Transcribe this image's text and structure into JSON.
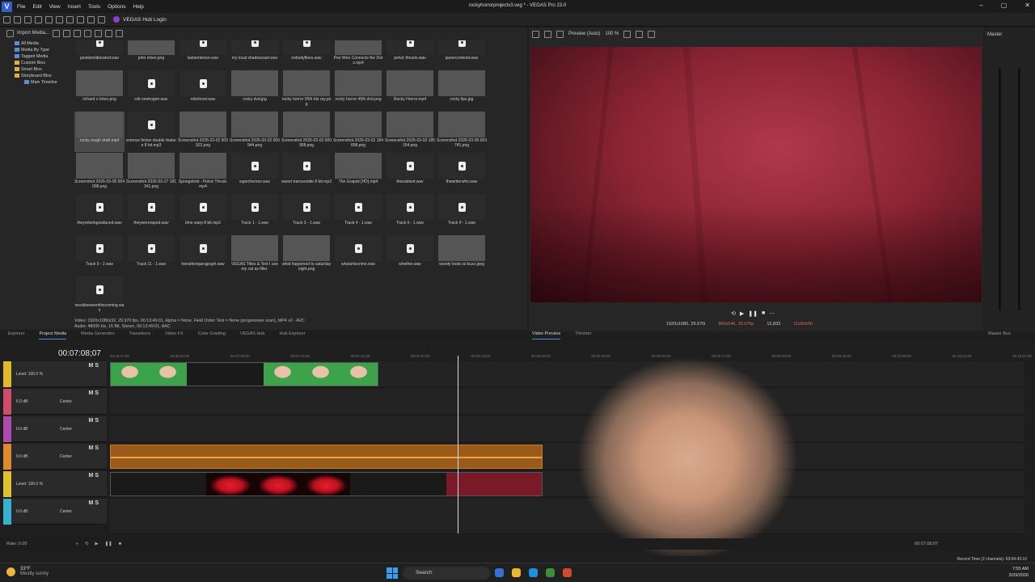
{
  "app": {
    "title": "rockyhorrorprojectv3.veg * - VEGAS Pro 23.0",
    "menu": [
      "File",
      "Edit",
      "View",
      "Insert",
      "Tools",
      "Options",
      "Help"
    ],
    "hub_login": "VEGAS Hub Login"
  },
  "project_media": {
    "toolbar_label": "Import Media...",
    "tree": [
      {
        "label": "All Media",
        "sub": false,
        "fold": false
      },
      {
        "label": "Media By Type",
        "sub": false,
        "fold": false
      },
      {
        "label": "Tagged Media",
        "sub": false,
        "fold": false
      },
      {
        "label": "Custom Bins",
        "sub": false,
        "fold": true
      },
      {
        "label": "Smart Bins",
        "sub": false,
        "fold": true
      },
      {
        "label": "Storyboard Bins",
        "sub": false,
        "fold": true
      },
      {
        "label": "Main Timeline",
        "sub": true,
        "fold": false
      }
    ],
    "items": [
      {
        "name": "janetismliberated.wav",
        "kind": "file"
      },
      {
        "name": "john oliver.png",
        "kind": "img"
      },
      {
        "name": "lastsentence.wav",
        "kind": "file"
      },
      {
        "name": "my local shadowcast.wav",
        "kind": "file"
      },
      {
        "name": "nobodyflees.wav",
        "kind": "file"
      },
      {
        "name": "Pee Wee Connects the Dots.mp4",
        "kind": "img"
      },
      {
        "name": "pelvic thrusts.wav",
        "kind": "file"
      },
      {
        "name": "queercontend.wav",
        "kind": "file"
      },
      {
        "name": "richard o brien.png",
        "kind": "img"
      },
      {
        "name": "rob oestrogen.wav",
        "kind": "file"
      },
      {
        "name": "robcloset.wav",
        "kind": "file"
      },
      {
        "name": "rocky dvd.jpg",
        "kind": "img"
      },
      {
        "name": "rocky horror 35th blu ray.png",
        "kind": "img"
      },
      {
        "name": "rocky horror 45th dvd.png",
        "kind": "img"
      },
      {
        "name": "Rocky Horror.mp4",
        "kind": "img"
      },
      {
        "name": "rocky lips.jpg",
        "kind": "img"
      },
      {
        "name": "rocky rough draft.mp4",
        "kind": "img"
      },
      {
        "name": "science fiction double feature 8 bit.mp3",
        "kind": "file"
      },
      {
        "name": "Screenshot 2026-03-02 000922.png",
        "kind": "img"
      },
      {
        "name": "Screenshot 2026-03-02 000944.png",
        "kind": "img"
      },
      {
        "name": "Screenshot 2026-03-02 000958.png",
        "kind": "img"
      },
      {
        "name": "Screenshot 2026-03-02 184858.png",
        "kind": "img"
      },
      {
        "name": "Screenshot 2026-03-02 185154.png",
        "kind": "img"
      },
      {
        "name": "Screenshot 2026-03-05 003741.png",
        "kind": "img"
      },
      {
        "name": "Screenshot 2026-03-05 004008.png",
        "kind": "img"
      },
      {
        "name": "Screenshot 2026-03-27 181341.png",
        "kind": "img"
      },
      {
        "name": "Spongebob - Pelvic Thrust.mp4",
        "kind": "img"
      },
      {
        "name": "superheroes.wav",
        "kind": "file"
      },
      {
        "name": "sweet transvestite 8 bit.mp3",
        "kind": "file"
      },
      {
        "name": "The Grapist [HD].mp4",
        "kind": "img"
      },
      {
        "name": "thesubtext.wav",
        "kind": "file"
      },
      {
        "name": "thewriterwho.wav",
        "kind": "file"
      },
      {
        "name": "theyrebeingseduced.wav",
        "kind": "file"
      },
      {
        "name": "theywereraped.wav",
        "kind": "file"
      },
      {
        "name": "time warp 8 bit.mp3",
        "kind": "file"
      },
      {
        "name": "Track 1 - 1.wav",
        "kind": "file"
      },
      {
        "name": "Track 3 - 1.wav",
        "kind": "file"
      },
      {
        "name": "Track 4 - 1.wav",
        "kind": "file"
      },
      {
        "name": "Track 6 - 1.wav",
        "kind": "file"
      },
      {
        "name": "Track 9 - 1.wav",
        "kind": "file"
      },
      {
        "name": "Track 9 - 2.wav",
        "kind": "file"
      },
      {
        "name": "Track 11 - 1.wav",
        "kind": "file"
      },
      {
        "name": "transitionparagraph.wav",
        "kind": "file"
      },
      {
        "name": "VEGAS Titles & Text I use my cat as filler.",
        "kind": "img"
      },
      {
        "name": "what happened to saturday night.png",
        "kind": "img"
      },
      {
        "name": "whatshiscrime.wav",
        "kind": "file"
      },
      {
        "name": "whether.wav",
        "kind": "file"
      },
      {
        "name": "woody looks at buzz.jpeg",
        "kind": "img"
      },
      {
        "name": "wouldveseenthiscoming.wav",
        "kind": "file"
      }
    ],
    "info_line1": "Video: 1920x1080x32, 29.970 fps, 00:13:49:01, Alpha = None, Field Order Test = None (progressive scan), MP4 v2 - AVC",
    "info_line2": "Audio: 48000 Hz, 16 Bit, Stereo, 00:13:49:01, AAC"
  },
  "left_tabs": [
    "Explorer",
    "Project Media",
    "Media Generator",
    "Transitions",
    "Video FX",
    "Color Grading",
    "VEGAS Hub",
    "Hub Explorer"
  ],
  "preview": {
    "mode": "Preview (Auto)",
    "zoom": "100 %",
    "project_res": "1920x1080, 29.970i",
    "preview_res": "960x540, 29.970p",
    "frame": "12,833",
    "display": "1120x630",
    "tabs": [
      "Video Preview",
      "Trimmer"
    ]
  },
  "master_bus": {
    "title": "Master",
    "tab": "Master Bus"
  },
  "timeline": {
    "timecode": "00:07:08;07",
    "ruler": [
      "00:06:37;00",
      "00:06:53;00",
      "00:07:09;00",
      "00:07:25;00",
      "00:07:41;00",
      "00:07:57;00",
      "00:08:13;00",
      "00:08:29;00",
      "00:08:45;00",
      "00:09:01;00",
      "00:09:17;00",
      "00:09:33;00",
      "00:09:49;00",
      "00:10:05;00",
      "00:10:21;00",
      "00:10:37;00"
    ],
    "tracks": [
      {
        "label": "Level: 100.0 %",
        "color": "#e0b830",
        "center": ""
      },
      {
        "label": "5.0 dB",
        "color": "#d04a6a",
        "center": "Center"
      },
      {
        "label": "0.0 dB",
        "color": "#b04ab0",
        "center": "Center"
      },
      {
        "label": "0.0 dB",
        "color": "#e08a30",
        "center": "Center"
      },
      {
        "label": "Level: 100.0 %",
        "color": "#e0c030",
        "center": ""
      },
      {
        "label": "0.0 dB",
        "color": "#3ab0d0",
        "center": "Center"
      }
    ],
    "rate": "Rate: 0.00",
    "end_time": "00:07:08;07",
    "record_time": "Record Time (2 channels): 53:04:43:10"
  },
  "taskbar": {
    "temp": "33°F",
    "weather": "Mostly sunny",
    "search": "Search",
    "time": "7:55 AM",
    "date": "3/29/2026"
  }
}
